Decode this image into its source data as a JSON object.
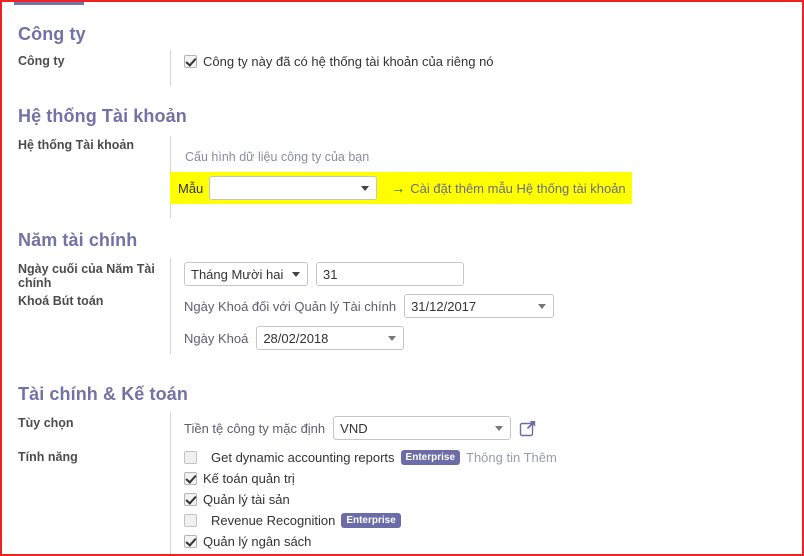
{
  "sections": {
    "company": {
      "title": "Công ty",
      "row_label": "Công ty",
      "checkbox_label": "Công ty này đã có hệ thống tài khoản của riêng nó",
      "checkbox_checked": true
    },
    "chart_of_accounts": {
      "title": "Hệ thống Tài khoản",
      "row_label": "Hệ thống Tài khoản",
      "hint": "Cấu hình dữ liệu công ty của bạn",
      "template_label": "Mẫu",
      "template_value": "",
      "template_placeholder": "",
      "install_link_arrow": "→",
      "install_link_text": "Cài đặt thêm mẫu Hệ thống tài khoản"
    },
    "fiscal_year": {
      "title": "Năm tài chính",
      "end_date_label": "Ngày cuối của Năm Tài chính",
      "end_month_value": "Tháng Mười hai",
      "end_day_value": "31",
      "lock_label": "Khoá Bút toán",
      "lock_mgmt_label": "Ngày Khoá đối với Quản lý Tài chính",
      "lock_mgmt_value": "31/12/2017",
      "lock_date_label": "Ngày Khoá",
      "lock_date_value": "28/02/2018"
    },
    "finance": {
      "title": "Tài chính & Kế toán",
      "options_label": "Tùy chọn",
      "currency_label": "Tiền tệ công ty mặc định",
      "currency_value": "VND",
      "features_label": "Tính năng",
      "features": [
        {
          "label": "Get dynamic accounting reports",
          "checked": false,
          "badge": "Enterprise",
          "info_link": "Thông tin Thêm"
        },
        {
          "label": "Kế toán quản trị",
          "checked": true,
          "badge": "",
          "info_link": ""
        },
        {
          "label": "Quản lý tài sản",
          "checked": true,
          "badge": "",
          "info_link": ""
        },
        {
          "label": "Revenue Recognition",
          "checked": false,
          "badge": "Enterprise",
          "info_link": ""
        },
        {
          "label": "Quản lý ngân sách",
          "checked": true,
          "badge": "",
          "info_link": ""
        }
      ]
    }
  },
  "icons": {
    "external_link": "external-link-icon",
    "dropdown_caret": "chevron-down-icon"
  },
  "colors": {
    "section_heading": "#7272a6",
    "highlight": "#ffff00",
    "badge_background": "#6c6ca8",
    "selected_field": "#d3d2ef",
    "border_frame": "#ee2222",
    "progress": "#7575a8"
  }
}
